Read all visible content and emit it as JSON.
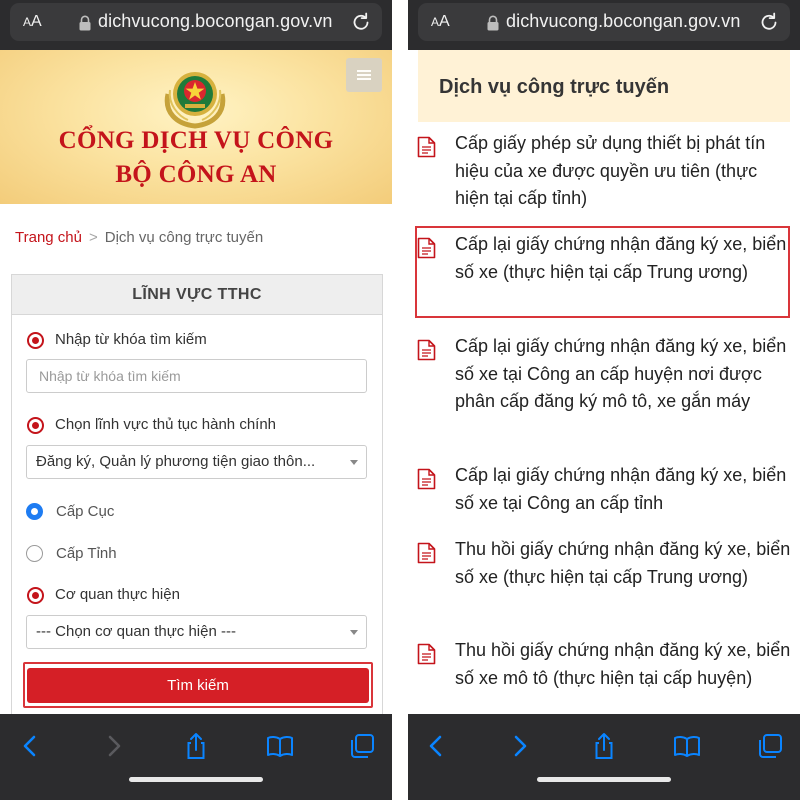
{
  "browser": {
    "text_size_label": "AA",
    "url": "dichvucong.bocongan.gov.vn"
  },
  "left": {
    "banner": {
      "line1": "CỔNG DỊCH VỤ CÔNG",
      "line2": "BỘ CÔNG AN"
    },
    "breadcrumb": {
      "home": "Trang chủ",
      "separator": ">",
      "current": "Dịch vụ công trực tuyến"
    },
    "panel": {
      "title": "LĨNH VỰC TTHC",
      "keyword_label": "Nhập từ khóa tìm kiếm",
      "keyword_value": "",
      "keyword_placeholder": "Nhập từ khóa tìm kiếm",
      "field_label": "Chọn lĩnh vực thủ tục hành chính",
      "field_selected": "Đăng ký, Quản lý phương tiện giao thôn...",
      "levels": [
        {
          "label": "Cấp Cục",
          "selected": true
        },
        {
          "label": "Cấp Tỉnh",
          "selected": false
        }
      ],
      "agency_label": "Cơ quan thực hiện",
      "agency_selected": "--- Chọn cơ quan thực hiện ---",
      "search_button": "Tìm kiếm"
    }
  },
  "right": {
    "header": "Dịch vụ công trực tuyến",
    "highlighted_index": 1,
    "services": [
      "Cấp giấy phép sử dụng thiết bị phát tín hiệu của xe được quyền ưu tiên (thực hiện tại cấp tỉnh)",
      "Cấp lại giấy chứng nhận đăng ký xe, biển số xe (thực hiện tại cấp Trung ương)",
      "Cấp lại giấy chứng nhận đăng ký xe, biển số xe tại Công an cấp huyện nơi được phân cấp đăng ký mô tô, xe gắn máy",
      "Cấp lại giấy chứng nhận đăng ký xe, biển số xe tại Công an cấp tỉnh",
      "Thu hồi giấy chứng nhận đăng ký xe, biển số xe (thực hiện tại cấp Trung ương)",
      "Thu hồi giấy chứng nhận đăng ký xe, biển số xe mô tô (thực hiện tại cấp huyện)"
    ]
  },
  "colors": {
    "brand_red": "#c4141b",
    "button_red": "#d51f26",
    "radio_blue": "#1e7cf2",
    "browser_chrome": "#2c2c2e",
    "ios_blue": "#0a84ff"
  },
  "icons": {
    "lock": "lock-icon",
    "reload": "reload-icon",
    "back": "chevron-left-icon",
    "forward": "chevron-right-icon",
    "share": "share-icon",
    "bookmarks": "book-icon",
    "tabs": "tabs-icon",
    "menu": "hamburger-icon",
    "document": "document-icon",
    "emblem": "police-emblem"
  }
}
